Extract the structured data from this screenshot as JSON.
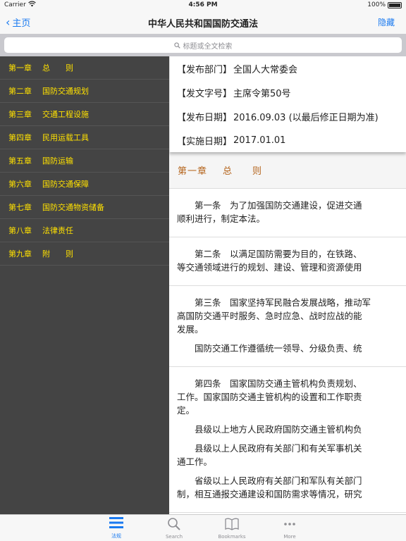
{
  "status_bar": {
    "carrier": "Carrier",
    "time": "4:56 PM",
    "battery": "100%"
  },
  "nav": {
    "back_label": "主页",
    "title": "中华人民共和国国防交通法",
    "hide_label": "隐藏"
  },
  "search": {
    "placeholder": "标题或全文检索"
  },
  "sidebar": {
    "items": [
      {
        "num": "第一章",
        "label": "总　　则"
      },
      {
        "num": "第二章",
        "label": "国防交通规划"
      },
      {
        "num": "第三章",
        "label": "交通工程设施"
      },
      {
        "num": "第四章",
        "label": "民用运载工具"
      },
      {
        "num": "第五章",
        "label": "国防运输"
      },
      {
        "num": "第六章",
        "label": "国防交通保障"
      },
      {
        "num": "第七章",
        "label": "国防交通物资储备"
      },
      {
        "num": "第八章",
        "label": "法律责任"
      },
      {
        "num": "第九章",
        "label": "附　　则"
      }
    ]
  },
  "meta": {
    "rows": [
      {
        "key": "【发布部门】",
        "value": "全国人大常委会"
      },
      {
        "key": "【发文字号】",
        "value": "主席令第50号"
      },
      {
        "key": "【发布日期】",
        "value": "2016.09.03 (以最后修正日期为准)"
      },
      {
        "key": "【实施日期】",
        "value": "2017.01.01"
      }
    ]
  },
  "chapter": {
    "num": "第一章",
    "title": "总　　则"
  },
  "articles": [
    {
      "paragraphs": [
        "　　第一条　为了加强国防交通建设，促进交通\n顺利进行，制定本法。"
      ]
    },
    {
      "paragraphs": [
        "　　第二条　以满足国防需要为目的，在铁路、\n等交通领域进行的规划、建设、管理和资源使用"
      ]
    },
    {
      "paragraphs": [
        "　　第三条　国家坚持军民融合发展战略，推动军\n高国防交通平时服务、急时应急、战时应战的能\n发展。",
        "　　国防交通工作遵循统一领导、分级负责、统"
      ]
    },
    {
      "paragraphs": [
        "　　第四条　国家国防交通主管机构负责规划、\n工作。国家国防交通主管机构的设置和工作职责\n定。",
        "　　县级以上地方人民政府国防交通主管机构负",
        "　　县级以上人民政府有关部门和有关军事机关\n通工作。",
        "　　省级以上人民政府有关部门和军队有关部门\n制，相互通报交通建设和国防需求等情况，研究"
      ]
    }
  ],
  "tabbar": {
    "tabs": [
      {
        "label": "法规",
        "icon": "list-icon"
      },
      {
        "label": "Search",
        "icon": "search-icon"
      },
      {
        "label": "Bookmarks",
        "icon": "book-icon"
      },
      {
        "label": "More",
        "icon": "more-icon"
      }
    ]
  }
}
